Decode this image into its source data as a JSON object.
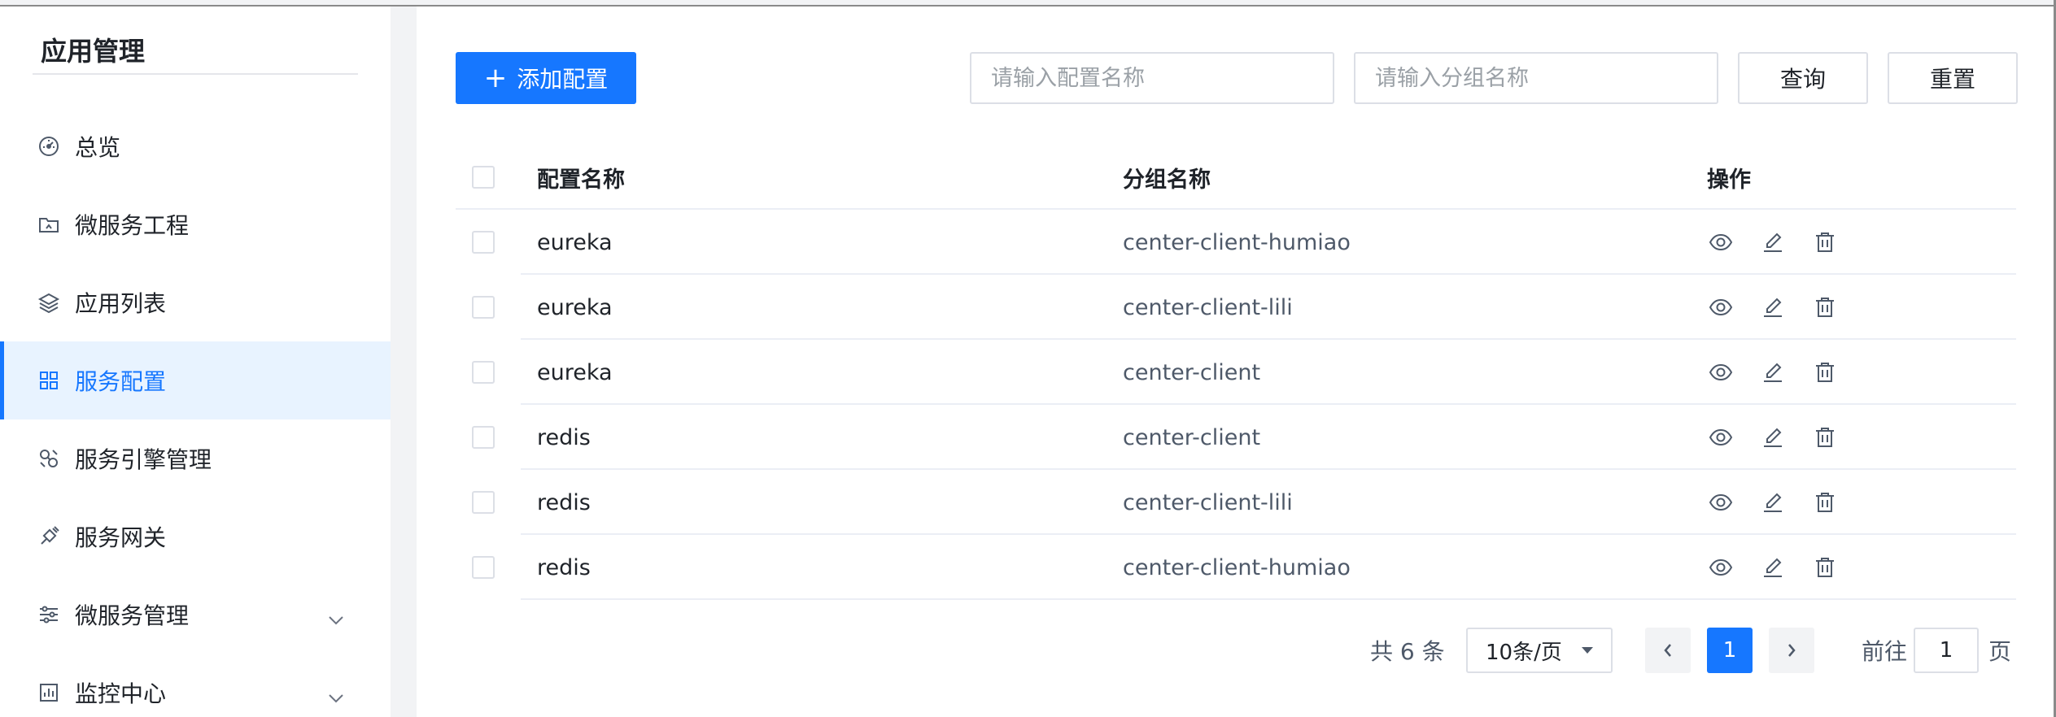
{
  "sidebar": {
    "title": "应用管理",
    "items": [
      {
        "label": "总览",
        "icon": "dashboard-icon",
        "active": false,
        "expandable": false
      },
      {
        "label": "微服务工程",
        "icon": "folder-icon",
        "active": false,
        "expandable": false
      },
      {
        "label": "应用列表",
        "icon": "layers-icon",
        "active": false,
        "expandable": false
      },
      {
        "label": "服务配置",
        "icon": "grid-icon",
        "active": true,
        "expandable": false
      },
      {
        "label": "服务引擎管理",
        "icon": "engine-icon",
        "active": false,
        "expandable": false
      },
      {
        "label": "服务网关",
        "icon": "gateway-icon",
        "active": false,
        "expandable": false
      },
      {
        "label": "微服务管理",
        "icon": "sliders-icon",
        "active": false,
        "expandable": true
      },
      {
        "label": "监控中心",
        "icon": "chart-icon",
        "active": false,
        "expandable": true
      }
    ]
  },
  "toolbar": {
    "add_label": "添加配置",
    "config_name_placeholder": "请输入配置名称",
    "group_name_placeholder": "请输入分组名称",
    "query_label": "查询",
    "reset_label": "重置"
  },
  "table": {
    "columns": [
      "配置名称",
      "分组名称",
      "操作"
    ],
    "rows": [
      {
        "name": "eureka",
        "group": "center-client-humiao"
      },
      {
        "name": "eureka",
        "group": "center-client-lili"
      },
      {
        "name": "eureka",
        "group": "center-client"
      },
      {
        "name": "redis",
        "group": "center-client"
      },
      {
        "name": "redis",
        "group": "center-client-lili"
      },
      {
        "name": "redis",
        "group": "center-client-humiao"
      }
    ],
    "actions": [
      "view-icon",
      "edit-icon",
      "delete-icon"
    ]
  },
  "pagination": {
    "total_text": "共 6 条",
    "page_size": "10条/页",
    "prev": "‹",
    "current_page": "1",
    "next": "›",
    "goto_label": "前往",
    "goto_value": "1",
    "page_suffix": "页"
  },
  "colors": {
    "primary": "#1677ff",
    "active_bg": "#e8f3ff",
    "border": "#dcdfe6"
  }
}
